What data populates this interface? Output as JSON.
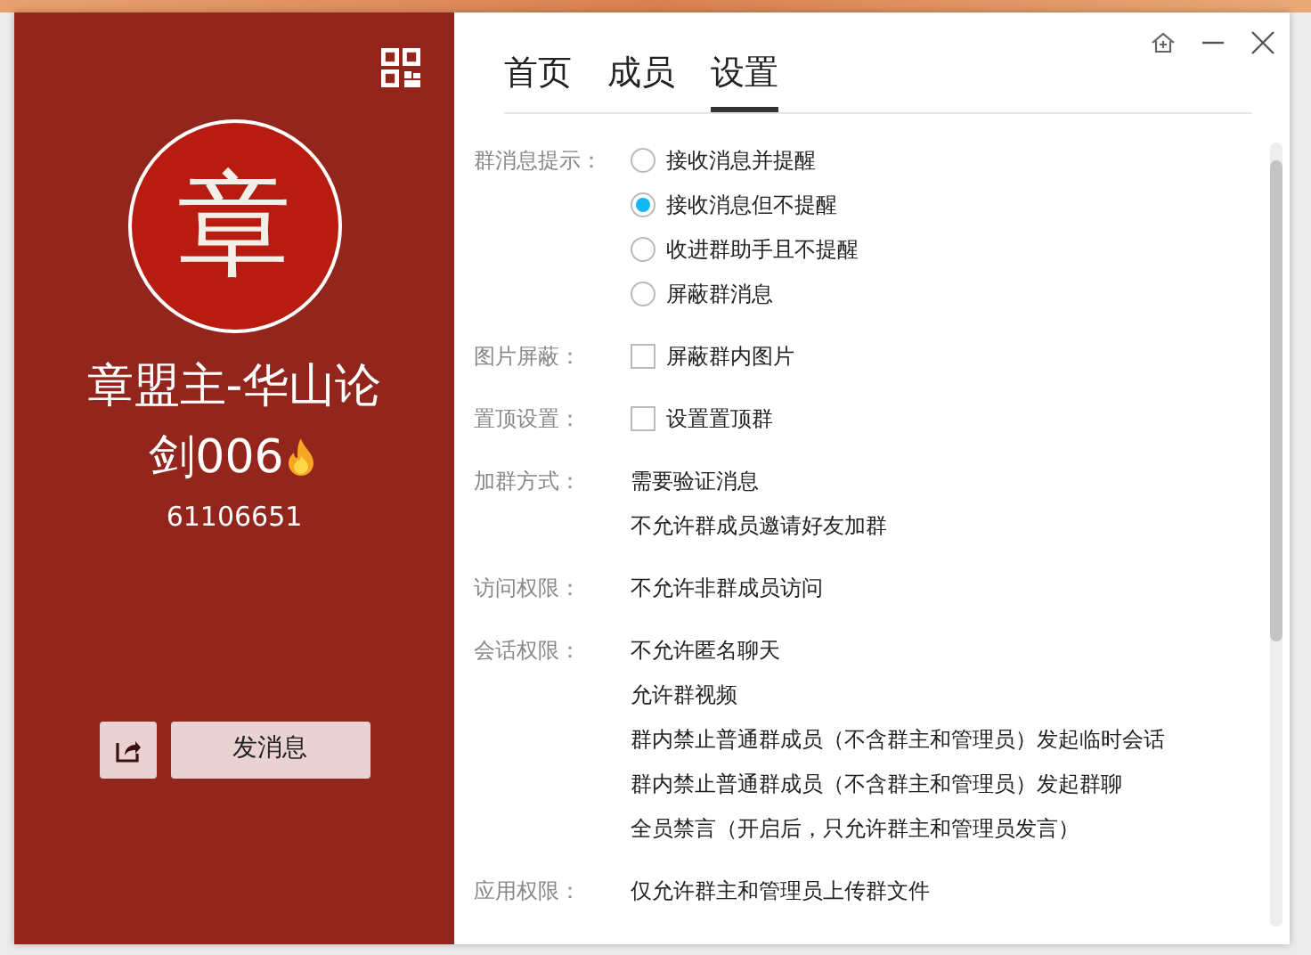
{
  "profile": {
    "avatar_char": "章",
    "name": "章盟主-华山论剑006",
    "group_number": "61106651",
    "send_button": "发消息"
  },
  "tabs": [
    {
      "label": "首页",
      "selected": false
    },
    {
      "label": "成员",
      "selected": false
    },
    {
      "label": "设置",
      "selected": true
    }
  ],
  "settings": [
    {
      "label": "群消息提示：",
      "items": [
        {
          "kind": "radio",
          "text": "接收消息并提醒",
          "selected": false
        },
        {
          "kind": "radio",
          "text": "接收消息但不提醒",
          "selected": true
        },
        {
          "kind": "radio",
          "text": "收进群助手且不提醒",
          "selected": false
        },
        {
          "kind": "radio",
          "text": "屏蔽群消息",
          "selected": false
        }
      ]
    },
    {
      "label": "图片屏蔽：",
      "items": [
        {
          "kind": "checkbox",
          "text": "屏蔽群内图片",
          "checked": false
        }
      ]
    },
    {
      "label": "置顶设置：",
      "items": [
        {
          "kind": "checkbox",
          "text": "设置置顶群",
          "checked": false
        }
      ]
    },
    {
      "label": "加群方式：",
      "items": [
        {
          "kind": "text",
          "text": "需要验证消息"
        },
        {
          "kind": "text",
          "text": "不允许群成员邀请好友加群"
        }
      ]
    },
    {
      "label": "访问权限：",
      "items": [
        {
          "kind": "text",
          "text": "不允许非群成员访问"
        }
      ]
    },
    {
      "label": "会话权限：",
      "items": [
        {
          "kind": "text",
          "text": "不允许匿名聊天"
        },
        {
          "kind": "text",
          "text": "允许群视频"
        },
        {
          "kind": "text",
          "text": "群内禁止普通群成员（不含群主和管理员）发起临时会话"
        },
        {
          "kind": "text",
          "text": "群内禁止普通群成员（不含群主和管理员）发起群聊"
        },
        {
          "kind": "text",
          "text": "全员禁言（开启后，只允许群主和管理员发言）"
        }
      ]
    },
    {
      "label": "应用权限：",
      "items": [
        {
          "kind": "text",
          "text": "仅允许群主和管理员上传群文件"
        }
      ]
    }
  ]
}
